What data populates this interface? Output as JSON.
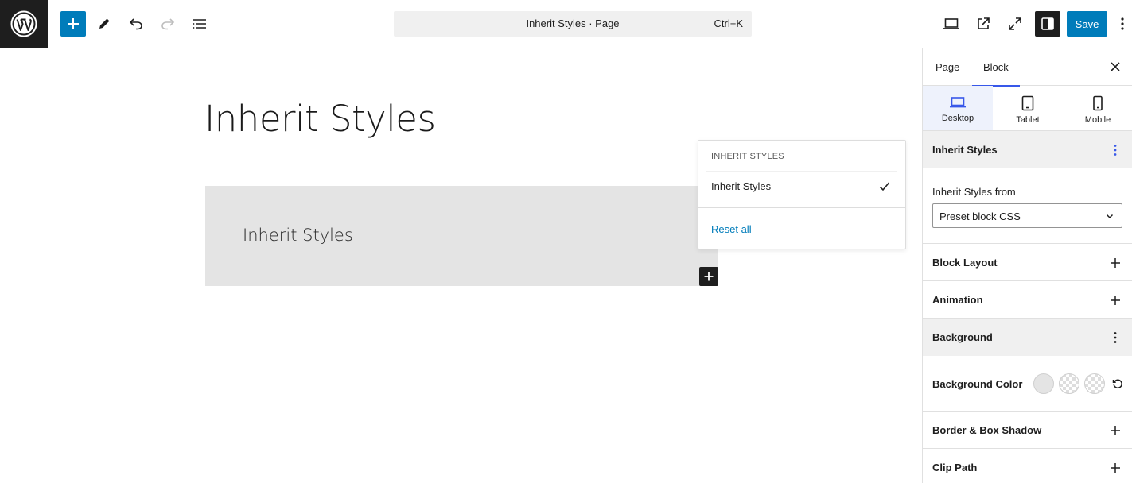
{
  "toolbar": {
    "command_title": "Inherit Styles · Page",
    "command_shortcut": "Ctrl+K",
    "save_label": "Save"
  },
  "canvas": {
    "page_title": "Inherit Styles",
    "block_text": "Inherit Styles"
  },
  "popover": {
    "heading": "INHERIT STYLES",
    "item_label": "Inherit Styles",
    "item_checked": true,
    "reset_label": "Reset all"
  },
  "sidebar": {
    "tabs": [
      {
        "label": "Page",
        "active": false
      },
      {
        "label": "Block",
        "active": true
      }
    ],
    "devices": [
      {
        "label": "Desktop",
        "icon": "laptop-icon",
        "active": true
      },
      {
        "label": "Tablet",
        "icon": "tablet-icon",
        "active": false
      },
      {
        "label": "Mobile",
        "icon": "mobile-icon",
        "active": false
      }
    ],
    "inherit_panel": {
      "title": "Inherit Styles",
      "field_label": "Inherit Styles from",
      "select_value": "Preset block CSS"
    },
    "panels": {
      "block_layout": "Block Layout",
      "animation": "Animation",
      "background": "Background",
      "border_box_shadow": "Border & Box Shadow",
      "clip_path": "Clip Path"
    },
    "background": {
      "color_label": "Background Color"
    }
  },
  "colors": {
    "accent": "#007cba",
    "tab_indicator": "#3858e9",
    "dark": "#1e1e1e",
    "block_bg": "#e4e4e4"
  }
}
